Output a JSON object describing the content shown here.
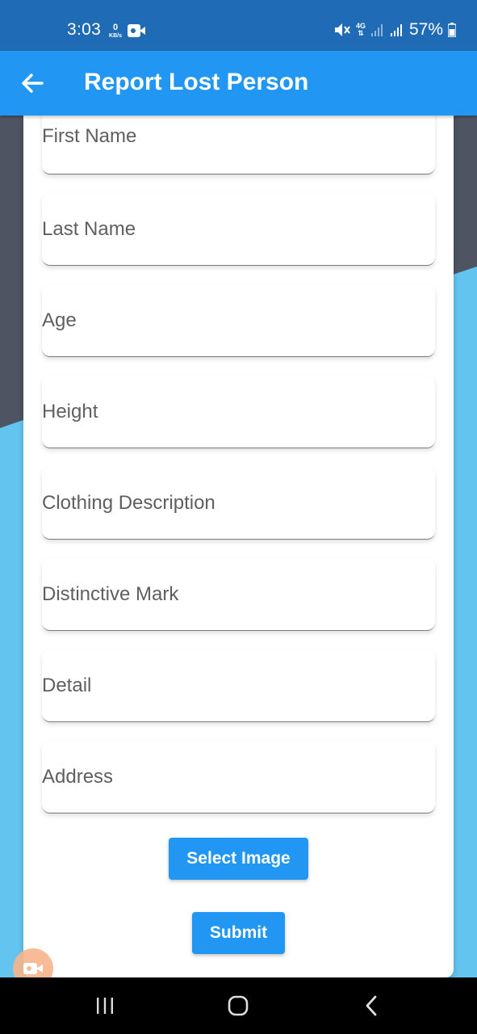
{
  "status_bar": {
    "time": "3:03",
    "net_speed_value": "0",
    "net_speed_unit": "KB/s",
    "network": "4G",
    "battery": "57%"
  },
  "app_bar": {
    "title": "Report Lost Person"
  },
  "form": {
    "fields": [
      {
        "placeholder": "First Name",
        "value": ""
      },
      {
        "placeholder": "Last Name",
        "value": ""
      },
      {
        "placeholder": "Age",
        "value": ""
      },
      {
        "placeholder": "Height",
        "value": ""
      },
      {
        "placeholder": "Clothing Description",
        "value": ""
      },
      {
        "placeholder": "Distinctive Mark",
        "value": ""
      },
      {
        "placeholder": "Detail",
        "value": ""
      },
      {
        "placeholder": "Address",
        "value": ""
      }
    ],
    "select_image_label": "Select Image",
    "submit_label": "Submit"
  },
  "colors": {
    "status_bar": "#1f6bb5",
    "app_bar": "#2196f3",
    "accent": "#2196f3",
    "bg_dark": "#4e5462",
    "bg_light_blue": "#63c5ef"
  },
  "icons": {
    "back": "arrow-left-icon",
    "recorder": "video-camera-icon",
    "mute": "mute-icon",
    "signal": "signal-icon",
    "battery": "battery-icon",
    "nav_recent": "recent-apps-icon",
    "nav_home": "home-icon",
    "nav_back": "chevron-left-icon"
  }
}
